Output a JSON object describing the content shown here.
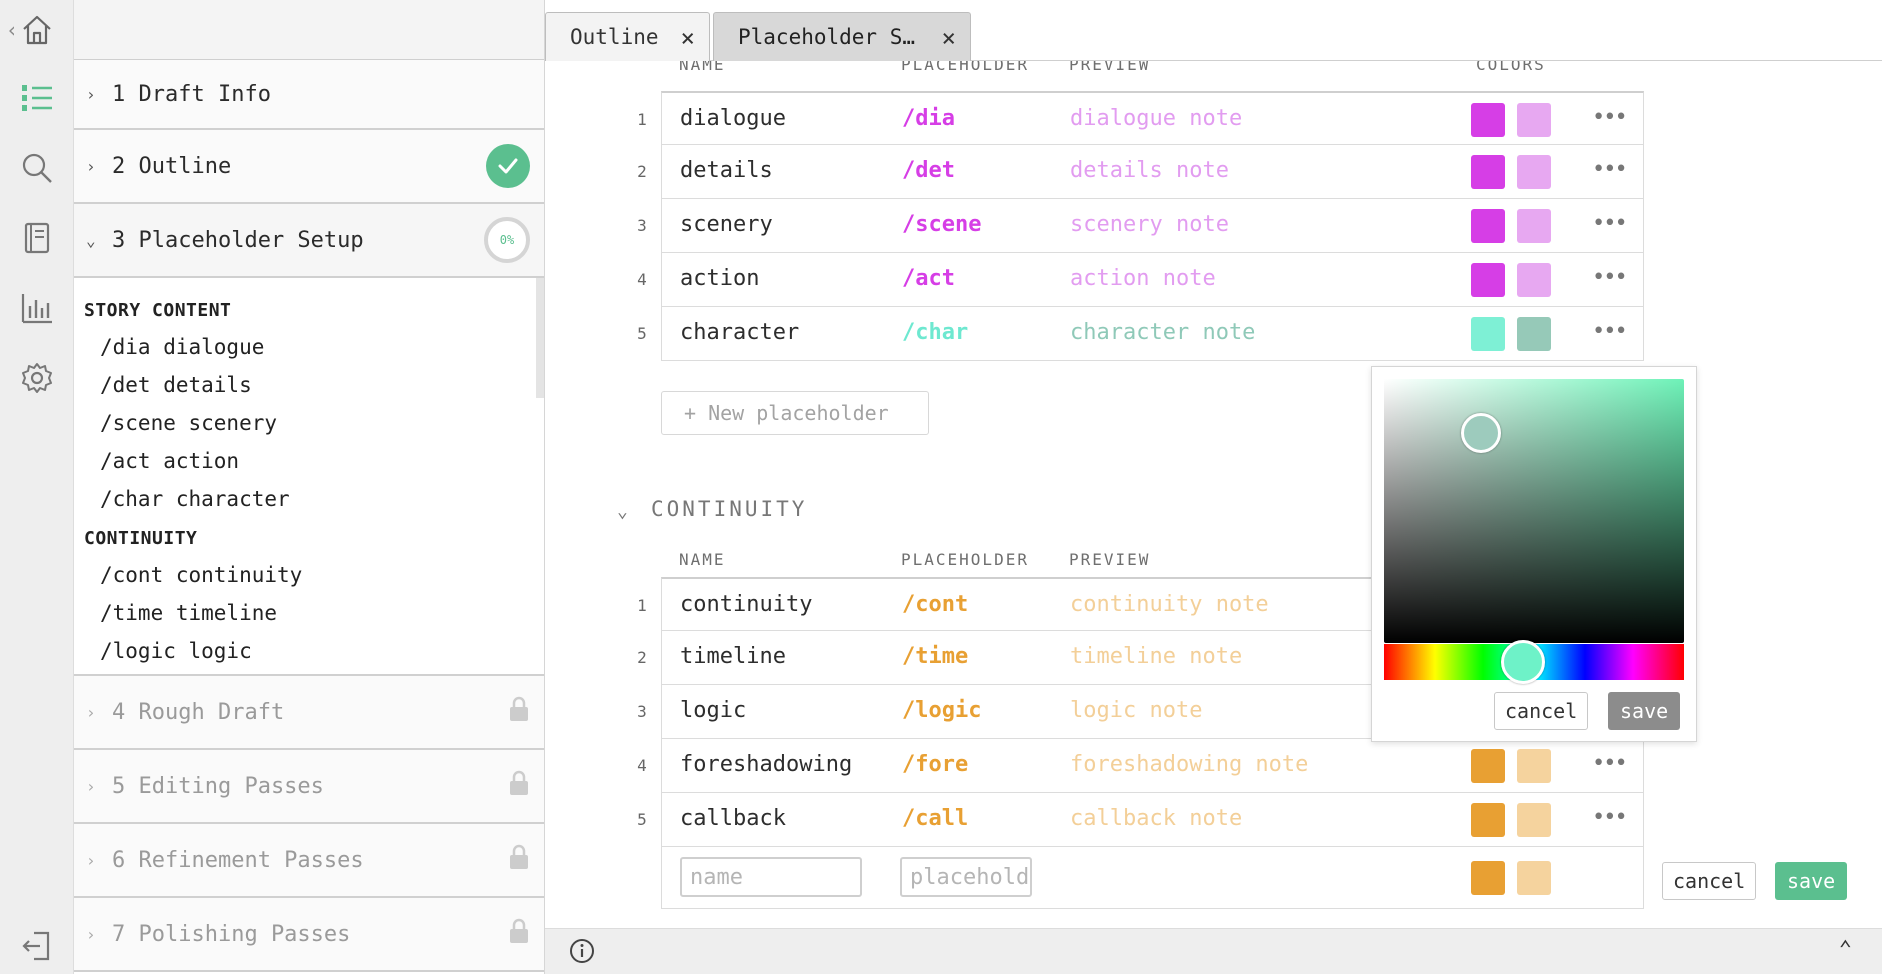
{
  "colors": {
    "accent": "#5bbf8f",
    "story_ph": "#d63ee6",
    "story_preview": "#e29cf0",
    "story_swatch1": "#d63ee6",
    "story_swatch2": "#e7a8f1",
    "char_ph": "#6ee8d0",
    "char_preview": "#8fc9b8",
    "char_swatch1": "#7ef0d5",
    "char_swatch2": "#96c9b8",
    "cont_ph": "#e8a033",
    "cont_preview": "#f3cf98",
    "cont_swatch1": "#e8a033",
    "cont_swatch2": "#f5d39e",
    "save_gray": "#8c8c8c"
  },
  "rail": {
    "icons": [
      "home-icon",
      "outline-list-icon",
      "search-icon",
      "notebook-icon",
      "stats-icon",
      "settings-icon",
      "exit-icon"
    ]
  },
  "sidebar": {
    "items": [
      {
        "label": "1 Draft Info"
      },
      {
        "label": "2 Outline",
        "status": "complete"
      },
      {
        "label": "3 Placeholder Setup",
        "progress": "0%"
      }
    ],
    "groups": [
      {
        "title": "STORY CONTENT",
        "entries": [
          "/dia dialogue",
          "/det details",
          "/scene scenery",
          "/act action",
          "/char character"
        ]
      },
      {
        "title": "CONTINUITY",
        "entries": [
          "/cont continuity",
          "/time timeline",
          "/logic logic"
        ]
      }
    ],
    "locked_items": [
      {
        "label": "4 Rough Draft"
      },
      {
        "label": "5 Editing Passes"
      },
      {
        "label": "6 Refinement Passes"
      },
      {
        "label": "7 Polishing Passes"
      }
    ]
  },
  "tabs": [
    {
      "label": "Outline"
    },
    {
      "label": "Placeholder S…"
    }
  ],
  "headers": {
    "name": "NAME",
    "placeholder": "PLACEHOLDER",
    "preview": "PREVIEW",
    "colors": "COLORS"
  },
  "story_rows": [
    {
      "num": "1",
      "name": "dialogue",
      "ph": "/dia",
      "preview": "dialogue note"
    },
    {
      "num": "2",
      "name": "details",
      "ph": "/det",
      "preview": "details note"
    },
    {
      "num": "3",
      "name": "scenery",
      "ph": "/scene",
      "preview": "scenery note"
    },
    {
      "num": "4",
      "name": "action",
      "ph": "/act",
      "preview": "action note"
    },
    {
      "num": "5",
      "name": "character",
      "ph": "/char",
      "preview": "character note"
    }
  ],
  "new_placeholder": "+ New placeholder",
  "continuity": {
    "title": "CONTINUITY",
    "rows": [
      {
        "num": "1",
        "name": "continuity",
        "ph": "/cont",
        "preview": "continuity note"
      },
      {
        "num": "2",
        "name": "timeline",
        "ph": "/time",
        "preview": "timeline note"
      },
      {
        "num": "3",
        "name": "logic",
        "ph": "/logic",
        "preview": "logic note"
      },
      {
        "num": "4",
        "name": "foreshadowing",
        "ph": "/fore",
        "preview": "foreshadowing note"
      },
      {
        "num": "5",
        "name": "callback",
        "ph": "/call",
        "preview": "callback note"
      }
    ],
    "new_row": {
      "name_placeholder": "name",
      "ph_placeholder": "placeholder",
      "cancel": "cancel",
      "save": "save"
    }
  },
  "picker": {
    "cancel": "cancel",
    "save": "save"
  }
}
